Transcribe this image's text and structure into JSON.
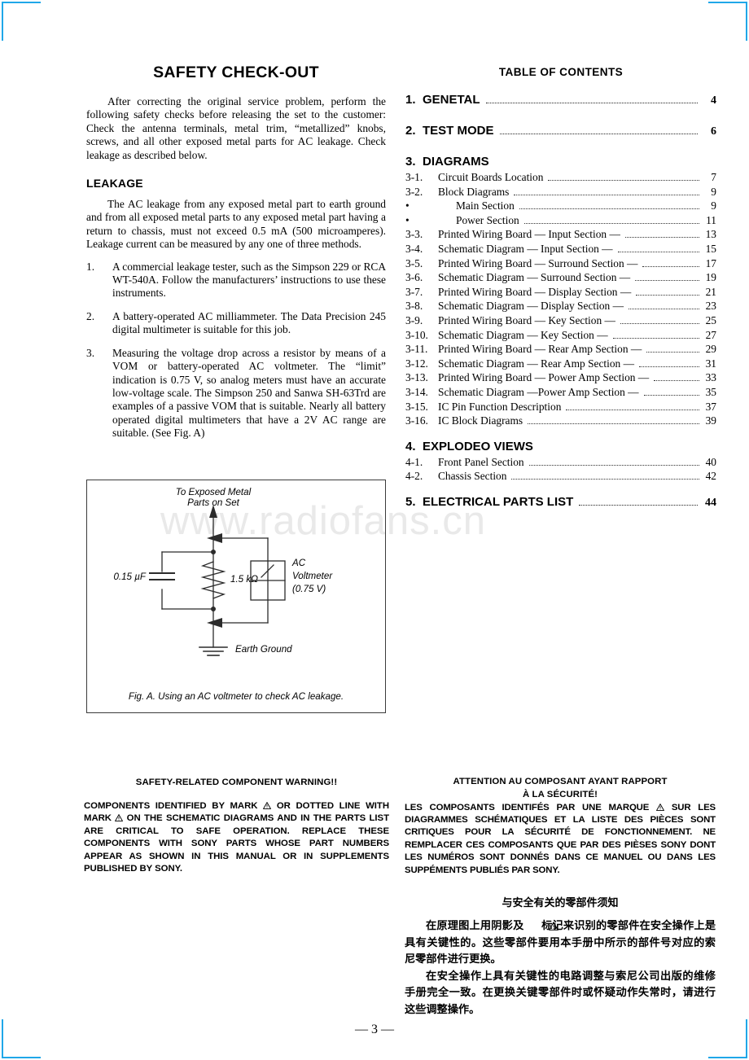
{
  "page": {
    "number_label": "— 3 —",
    "watermark": "www.radiofans.cn"
  },
  "left_column": {
    "title": "SAFETY  CHECK-OUT",
    "intro": "After correcting the original service problem, perform the following safety checks before releasing the set to the customer: Check the antenna terminals, metal trim, “metallized” knobs, screws, and all other exposed metal parts for AC leakage. Check leakage as described below.",
    "leakage_heading": "LEAKAGE",
    "leakage_intro": "The AC leakage from any exposed metal part to earth ground and from all exposed metal parts to any exposed metal part having a return to chassis, must not exceed 0.5 mA (500 microamperes). Leakage current can be measured by any one of three methods.",
    "methods": [
      {
        "num": "1.",
        "text": "A commercial leakage tester, such as the Simpson 229 or RCA WT-540A. Follow the manufacturers’ instructions to use these instruments."
      },
      {
        "num": "2.",
        "text": "A battery-operated AC milliammeter. The Data Precision 245 digital multimeter is suitable for this job."
      },
      {
        "num": "3.",
        "text": "Measuring the voltage drop across a resistor by means of a VOM or battery-operated AC voltmeter. The “limit” indication is 0.75 V, so analog meters must have an accurate low-voltage scale. The Simpson 250 and Sanwa SH-63Trd are examples of a passive VOM that is suitable. Nearly all battery operated digital multimeters that have a 2V AC range are suitable. (See Fig. A)"
      }
    ]
  },
  "figure": {
    "top_label_line1": "To Exposed Metal",
    "top_label_line2": "Parts on Set",
    "capacitor_label": "0.15 µF",
    "resistor_label": "1.5 kΩ",
    "meter_label_line1": "AC",
    "meter_label_line2": "Voltmeter",
    "meter_label_line3": "(0.75 V)",
    "ground_label": "Earth Ground",
    "caption": "Fig. A.  Using an AC voltmeter to check AC leakage."
  },
  "toc": {
    "title": "TABLE OF CONTENTS",
    "major": [
      {
        "num": "1.",
        "label": "GENETAL",
        "page": "4"
      },
      {
        "num": "2.",
        "label": "TEST MODE",
        "page": "6"
      },
      {
        "num": "3.",
        "label": "DIAGRAMS",
        "page": ""
      },
      {
        "num": "4.",
        "label": "EXPLODEO VIEWS",
        "page": ""
      },
      {
        "num": "5.",
        "label": "ELECTRICAL PARTS LIST",
        "page": "44"
      }
    ],
    "diagrams": [
      {
        "num": "3-1.",
        "label": "Circuit Boards Location",
        "page": "7"
      },
      {
        "num": "3-2.",
        "label": "Block Diagrams",
        "page": "9"
      },
      {
        "num": "•",
        "label": "Main Section",
        "page": "9",
        "bullet": true
      },
      {
        "num": "•",
        "label": "Power Section",
        "page": "11",
        "bullet": true
      },
      {
        "num": "3-3.",
        "label": "Printed Wiring Board — Input Section —",
        "page": "13"
      },
      {
        "num": "3-4.",
        "label": "Schematic Diagram — Input Section —",
        "page": "15"
      },
      {
        "num": "3-5.",
        "label": "Printed Wiring Board — Surround Section —",
        "page": "17"
      },
      {
        "num": "3-6.",
        "label": "Schematic Diagram — Surround Section —",
        "page": "19"
      },
      {
        "num": "3-7.",
        "label": "Printed Wiring Board — Display Section —",
        "page": "21"
      },
      {
        "num": "3-8.",
        "label": "Schematic Diagram — Display Section —",
        "page": "23"
      },
      {
        "num": "3-9.",
        "label": "Printed Wiring Board — Key Section —",
        "page": "25"
      },
      {
        "num": "3-10.",
        "label": "Schematic  Diagram — Key Section —",
        "page": "27"
      },
      {
        "num": "3-11.",
        "label": "Printed Wiring Board — Rear Amp Section —",
        "page": "29"
      },
      {
        "num": "3-12.",
        "label": "Schematic Diagram — Rear Amp Section —",
        "page": "31"
      },
      {
        "num": "3-13.",
        "label": "Printed Wiring Board — Power Amp Section —",
        "page": "33"
      },
      {
        "num": "3-14.",
        "label": "Schematic Diagram —Power Amp Section —",
        "page": "35"
      },
      {
        "num": "3-15.",
        "label": "IC Pin Function Description",
        "page": "37"
      },
      {
        "num": "3-16.",
        "label": "IC Block Diagrams",
        "page": "39"
      }
    ],
    "exploded": [
      {
        "num": "4-1.",
        "label": "Front Panel Section",
        "page": "40"
      },
      {
        "num": "4-2.",
        "label": "Chassis Section",
        "page": "42"
      }
    ]
  },
  "warning_en": {
    "heading": "SAFETY-RELATED COMPONENT WARNING!!",
    "body_part1": "COMPONENTS IDENTIFIED BY MARK",
    "body_part2": "OR DOTTED LINE WITH MARK",
    "body_part3": "ON THE SCHEMATIC DIAGRAMS AND IN THE PARTS LIST ARE CRITICAL TO SAFE OPERATION. REPLACE THESE COMPONENTS WITH SONY PARTS WHOSE PART NUMBERS APPEAR AS SHOWN IN THIS MANUAL OR IN SUPPLEMENTS PUBLISHED BY SONY."
  },
  "warning_fr": {
    "heading_line1": "ATTENTION AU COMPOSANT AYANT RAPPORT",
    "heading_line2": "À LA SÉCURITÉ!",
    "body_part1": "LES COMPOSANTS IDENTIFÉS PAR UNE MARQUE",
    "body_part2": "SUR LES DIAGRAMMES SCHÉMATIQUES ET LA LISTE DES PIÈCES SONT CRITIQUES POUR LA SÉCURITÉ DE FONCTIONNEMENT. NE REMPLACER CES COMPOSANTS QUE PAR DES PIÈSES SONY DONT LES NUMÉROS SONT DONNÉS DANS CE MANUEL OU DANS LES SUPPÉMENTS PUBLIÉS PAR SONY."
  },
  "warning_cn": {
    "heading": "与安全有关的零部件须知",
    "para1_part1": "在原理图上用阴影及",
    "para1_part2": "标记来识别的零部件在安全操作上是具有关键性的。这些零部件要用本手册中所示的部件号对应的索尼零部件进行更换。",
    "para2": "在安全操作上具有关键性的电路调整与索尼公司出版的维修手册完全一致。在更换关键零部件时或怀疑动作失常时，请进行这些调整操作。"
  },
  "colors": {
    "corner_mark": "#1fa7e8",
    "watermark": "#e9e9e9",
    "rule": "#3b3b3b"
  }
}
